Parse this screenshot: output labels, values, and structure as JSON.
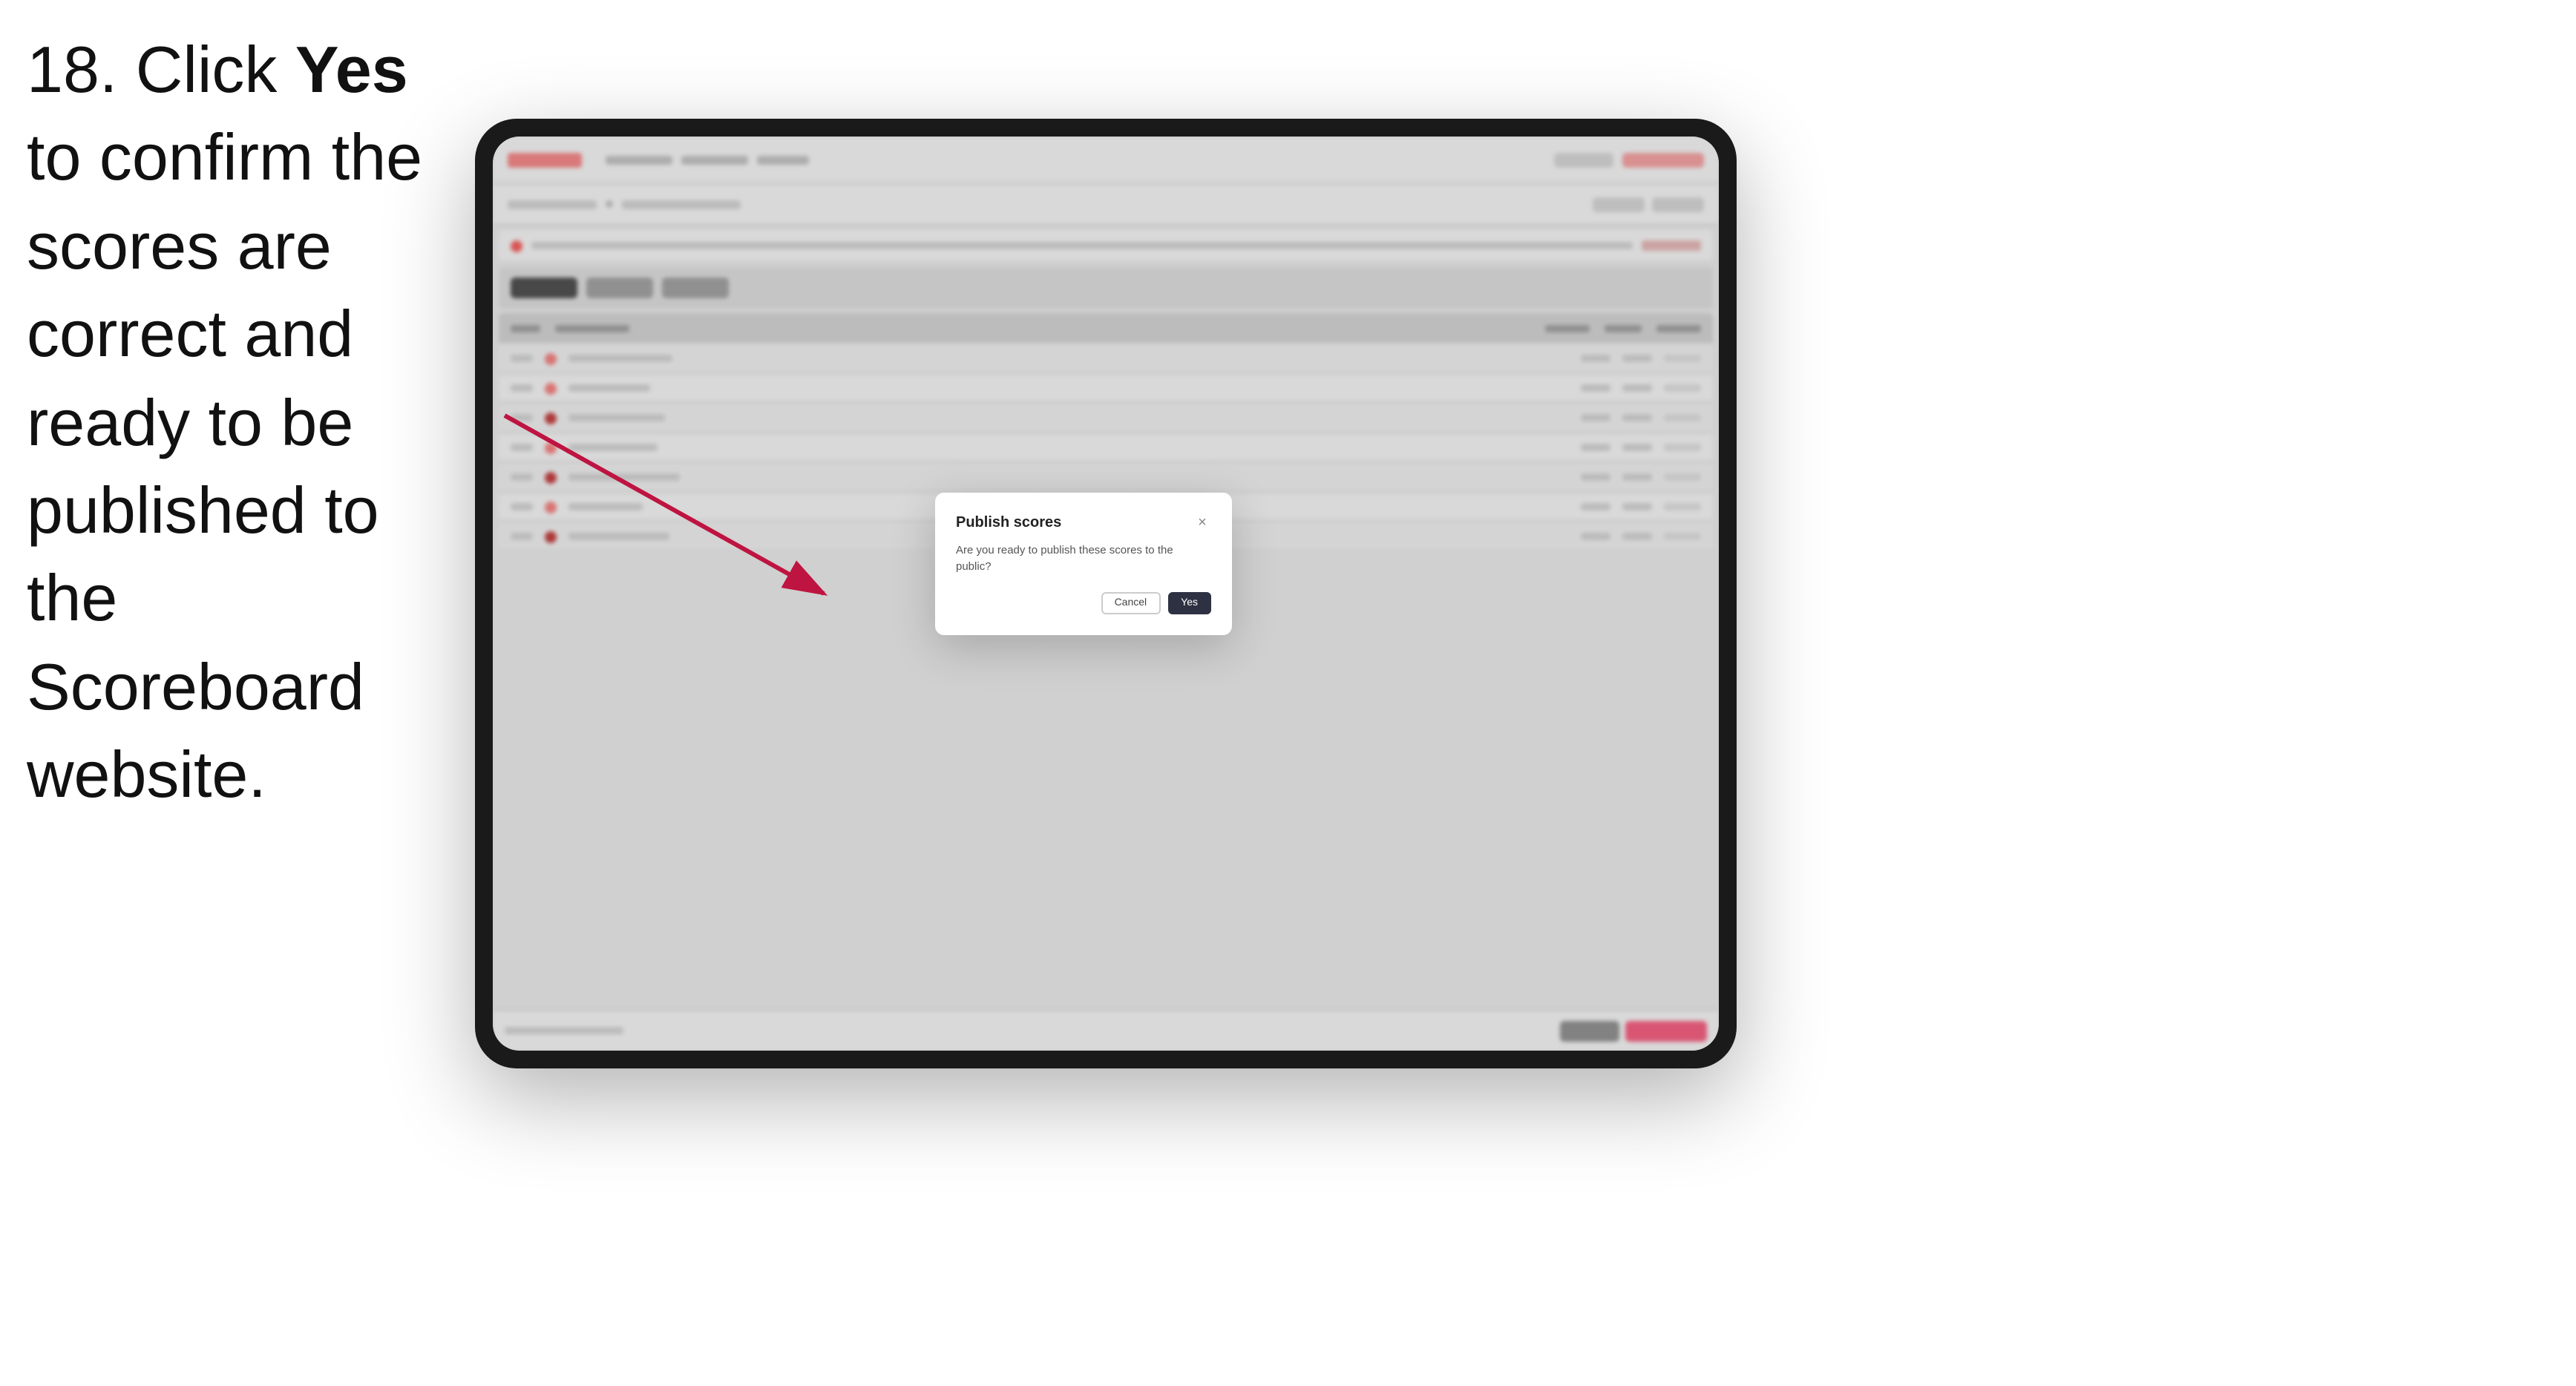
{
  "instruction": {
    "step_number": "18.",
    "text_parts": [
      {
        "text": "18. Click ",
        "bold": false
      },
      {
        "text": "Yes",
        "bold": true
      },
      {
        "text": " to confirm the scores are correct and ready to be published to the Scoreboard website.",
        "bold": false
      }
    ],
    "full_text": "18. Click Yes to confirm the scores are correct and ready to be published to the Scoreboard website."
  },
  "modal": {
    "title": "Publish scores",
    "body_text": "Are you ready to publish these scores to the public?",
    "cancel_label": "Cancel",
    "yes_label": "Yes",
    "close_icon": "×"
  },
  "tablet": {
    "screen_bg": "#f5f5f5"
  }
}
